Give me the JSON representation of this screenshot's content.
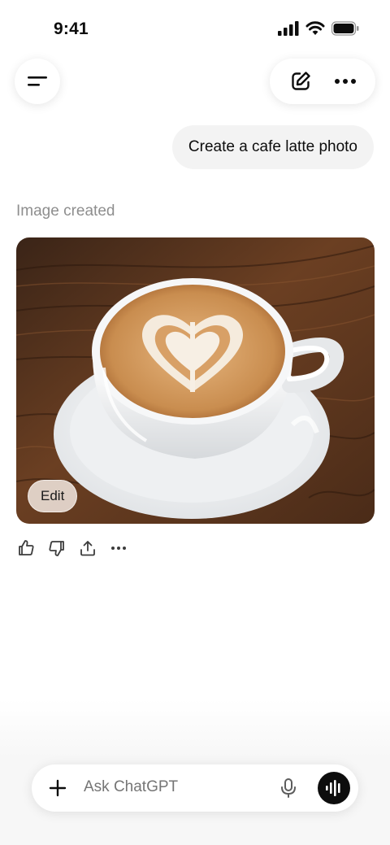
{
  "status_bar": {
    "time": "9:41"
  },
  "header": {
    "menu_icon": "menu-icon",
    "new_chat_icon": "edit-compose-icon",
    "more_icon": "more-horizontal-icon"
  },
  "conversation": {
    "user_message": "Create a cafe latte photo",
    "assistant_label": "Image created",
    "image": {
      "edit_label": "Edit"
    },
    "actions": [
      "thumbs-up-icon",
      "thumbs-down-icon",
      "share-icon",
      "more-horizontal-icon"
    ]
  },
  "composer": {
    "placeholder": "Ask ChatGPT",
    "plus_icon": "plus-icon",
    "mic_icon": "microphone-icon",
    "voice_icon": "voice-mode-icon"
  },
  "colors": {
    "bubble": "#f3f3f3",
    "muted_text": "#8e8e8e",
    "voice_button": "#0d0d0d"
  }
}
